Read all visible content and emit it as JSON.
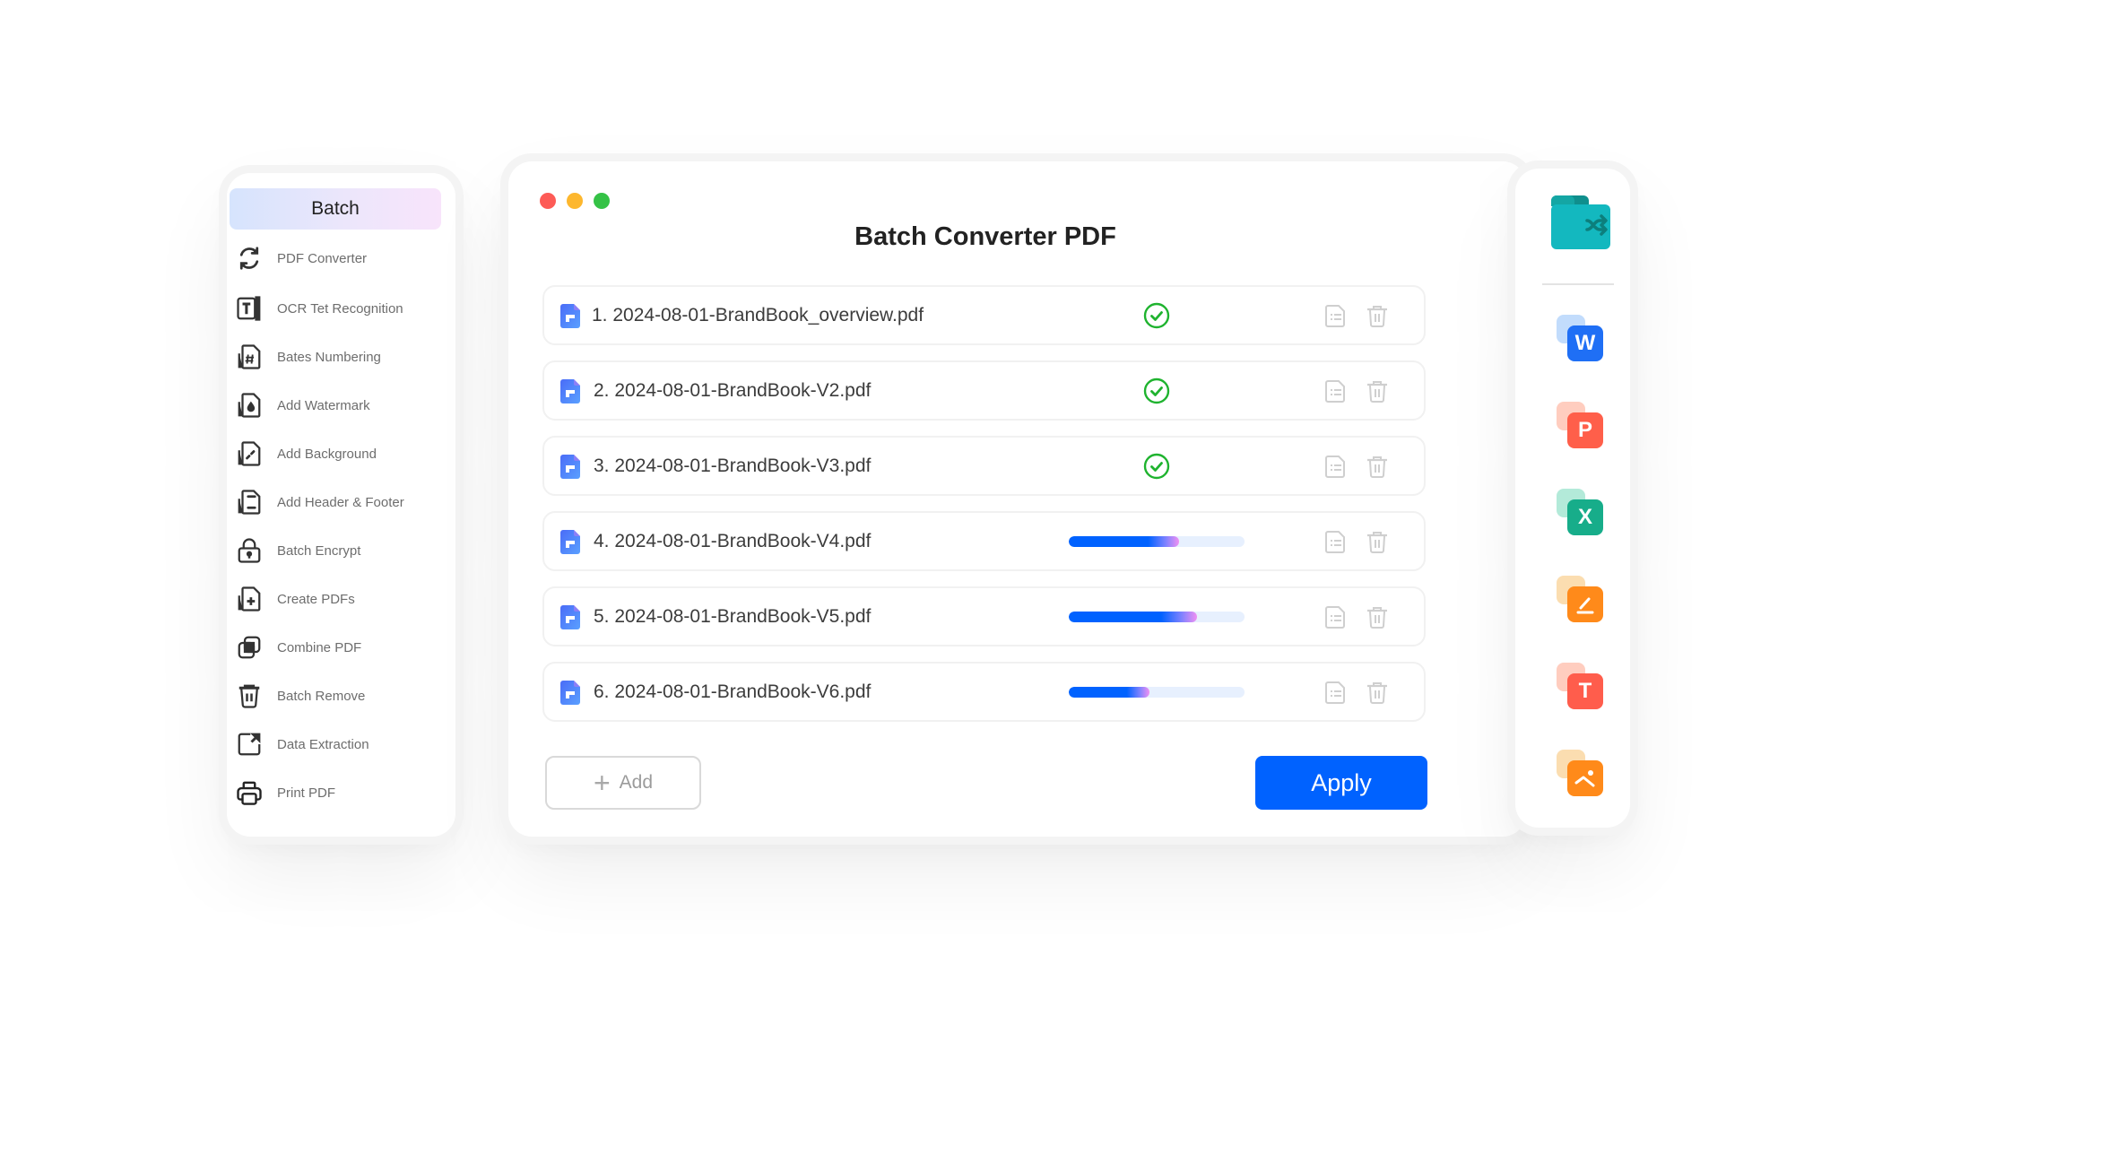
{
  "sidebar": {
    "header_label": "Batch",
    "items": [
      {
        "label": "PDF Converter",
        "icon": "refresh-icon"
      },
      {
        "label": "OCR Tet Recognition",
        "icon": "ocr-text-icon"
      },
      {
        "label": "Bates Numbering",
        "icon": "hash-document-icon"
      },
      {
        "label": "Add Watermark",
        "icon": "watermark-drop-icon"
      },
      {
        "label": "Add Background",
        "icon": "background-document-icon"
      },
      {
        "label": "Add Header & Footer",
        "icon": "header-footer-icon"
      },
      {
        "label": "Batch Encrypt",
        "icon": "lock-icon"
      },
      {
        "label": "Create PDFs",
        "icon": "create-document-icon"
      },
      {
        "label": "Combine PDF",
        "icon": "combine-icon"
      },
      {
        "label": "Batch Remove",
        "icon": "trash-icon"
      },
      {
        "label": "Data Extraction",
        "icon": "export-icon"
      },
      {
        "label": "Print PDF",
        "icon": "printer-icon"
      }
    ]
  },
  "main": {
    "title": "Batch Converter PDF",
    "files": [
      {
        "name": "1. 2024-08-01-BrandBook_overview.pdf",
        "status": "done",
        "progress": 100
      },
      {
        "name": "2. 2024-08-01-BrandBook-V2.pdf",
        "status": "done",
        "progress": 100
      },
      {
        "name": "3. 2024-08-01-BrandBook-V3.pdf",
        "status": "done",
        "progress": 100
      },
      {
        "name": "4. 2024-08-01-BrandBook-V4.pdf",
        "status": "in-progress",
        "progress": 63
      },
      {
        "name": "5. 2024-08-01-BrandBook-V5.pdf",
        "status": "in-progress",
        "progress": 73
      },
      {
        "name": "6. 2024-08-01-BrandBook-V6.pdf",
        "status": "in-progress",
        "progress": 46
      }
    ],
    "add_label": "Add",
    "apply_label": "Apply"
  },
  "right_panel": {
    "top_icon": "folder-shuffle-icon",
    "formats": [
      {
        "name": "word",
        "glyph": "W",
        "color": "#1f6ff5",
        "back": "#c2dcfc"
      },
      {
        "name": "powerpoint",
        "glyph": "P",
        "color": "#ff5f4a",
        "back": "#ffcdbf"
      },
      {
        "name": "excel",
        "glyph": "X",
        "color": "#17ad8a",
        "back": "#b3ead9"
      },
      {
        "name": "edit",
        "glyph": "pen",
        "color": "#ff8a1a",
        "back": "#fbddb0"
      },
      {
        "name": "text",
        "glyph": "T",
        "color": "#ff5d4c",
        "back": "#ffcdbf"
      },
      {
        "name": "image",
        "glyph": "image",
        "color": "#ff8a1a",
        "back": "#fbddb0"
      }
    ]
  },
  "colors": {
    "accent": "#0062ff",
    "success": "#1fb32f",
    "progress_track": "#e7f0fe"
  }
}
